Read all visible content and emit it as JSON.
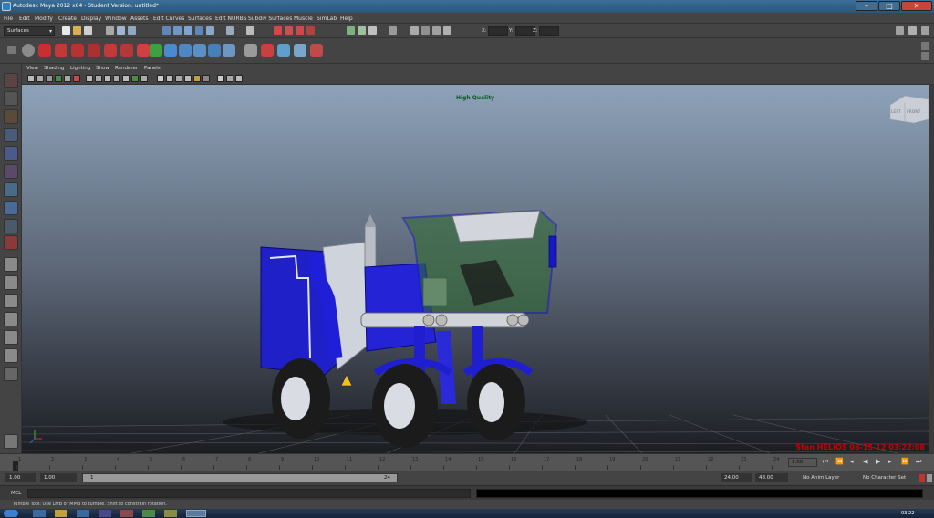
{
  "window": {
    "title": "Autodesk Maya 2012 x64 - Student Version: untitled*"
  },
  "menubar": {
    "items": [
      "File",
      "Edit",
      "Modify",
      "Create",
      "Display",
      "Window",
      "Assets",
      "Edit Curves",
      "Surfaces",
      "Edit NURBS",
      "Subdiv Surfaces",
      "Muscle",
      "SimLab",
      "Help"
    ]
  },
  "status_line": {
    "mode": "Surfaces",
    "x_label": "X:",
    "y_label": "Y:",
    "z_label": "Z:"
  },
  "panel_menu": {
    "items": [
      "View",
      "Shading",
      "Lighting",
      "Show",
      "Renderer",
      "Panels"
    ]
  },
  "viewport": {
    "quality_label": "High Quality",
    "cube_left": "LEFT",
    "cube_front": "FRONT",
    "watermark": "Stan HELIOS 08-15-12 03:22:08"
  },
  "time_slider": {
    "ticks": [
      "1",
      "2",
      "3",
      "4",
      "5",
      "6",
      "7",
      "8",
      "9",
      "10",
      "11",
      "12",
      "13",
      "14",
      "15",
      "16",
      "17",
      "18",
      "19",
      "20",
      "21",
      "22",
      "23",
      "24"
    ],
    "current_frame": "1.00"
  },
  "range_slider": {
    "start_time": "1.00",
    "playback_start": "1.00",
    "range_start_label": "1",
    "range_end_label": "24",
    "playback_end": "24.00",
    "end_time": "48.00",
    "anim_layer": "No Anim Layer",
    "character_set": "No Character Set"
  },
  "command_line": {
    "label": "MEL"
  },
  "help_line": {
    "text": "Tumble Tool: Use LMB or MMB to tumble. Shift to constrain rotation."
  },
  "taskbar": {
    "clock": "03:22"
  },
  "colors": {
    "accent": "#2b5576",
    "vehicle_blue": "#1a1acc",
    "watermark_red": "#cc0000"
  }
}
